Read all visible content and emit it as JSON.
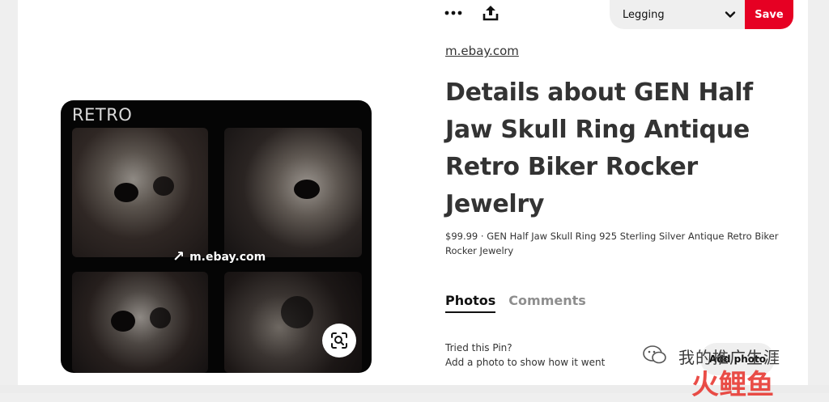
{
  "header": {
    "board_select": "Legging",
    "save_label": "Save",
    "icons": [
      "more-icon",
      "share-icon",
      "chevron-down-icon"
    ]
  },
  "pin_image": {
    "overlay_text": "RETRO",
    "source_overlay": "m.ebay.com",
    "icons": [
      "arrow-up-right-icon",
      "visual-search-icon"
    ]
  },
  "pin": {
    "source_link": "m.ebay.com",
    "title": "Details about GEN Half Jaw Skull Ring Antique Retro Biker Rocker Jewelry",
    "description": "$99.99 · GEN Half Jaw Skull Ring 925 Sterling Silver Antique Retro Biker Rocker Jewelry"
  },
  "tabs": [
    {
      "label": "Photos",
      "active": true
    },
    {
      "label": "Comments",
      "active": false
    }
  ],
  "tried": {
    "title": "Tried this Pin?",
    "subtitle": "Add a photo to show how it went",
    "button_label": "Add photo"
  },
  "watermark": {
    "text": "我的推广生涯",
    "logo": "火鲤鱼"
  },
  "colors": {
    "accent": "#e60023",
    "title_text": "#333333",
    "image_bg": "#050505"
  }
}
